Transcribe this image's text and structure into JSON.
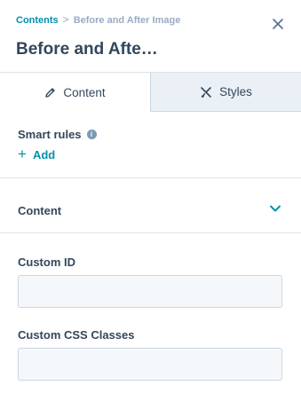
{
  "breadcrumb": {
    "parent": "Contents",
    "separator": ">",
    "current": "Before and After Image"
  },
  "header": {
    "title": "Before and Afte…",
    "close_icon": "close-icon"
  },
  "tabs": [
    {
      "label": "Content",
      "icon": "pencil-icon",
      "active": true
    },
    {
      "label": "Styles",
      "icon": "brush-icon",
      "active": false
    }
  ],
  "smart_rules": {
    "label": "Smart rules",
    "info_glyph": "i",
    "add_symbol": "+",
    "add_label": "Add"
  },
  "content_section": {
    "label": "Content",
    "expanded": false
  },
  "fields": {
    "custom_id": {
      "label": "Custom ID",
      "value": ""
    },
    "custom_css": {
      "label": "Custom CSS Classes",
      "value": ""
    }
  },
  "colors": {
    "accent": "#0091ae",
    "text": "#33475b",
    "muted": "#99acc2",
    "panel_bg": "#f5f8fa"
  }
}
